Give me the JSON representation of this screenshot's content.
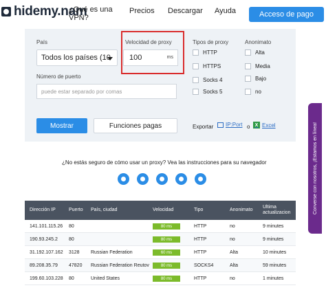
{
  "header": {
    "logo_text": "hidemy.nam",
    "nav_whatis": "¿Qué es una VPN?",
    "nav_precios": "Precios",
    "nav_descargar": "Descargar",
    "nav_ayuda": "Ayuda",
    "cta_label": "Acceso de pago"
  },
  "filters": {
    "country_label": "País",
    "country_value": "Todos los países (10",
    "speed_label": "Velocidad de proxy",
    "speed_value": "100",
    "speed_unit": "ms",
    "port_label": "Número de puerto",
    "port_placeholder": "puede estar separado por comas",
    "types_label": "Tipos de proxy",
    "types": [
      "HTTP",
      "HTTPS",
      "Socks 4",
      "Socks 5"
    ],
    "anon_label": "Anonimato",
    "anon": [
      "Alta",
      "Media",
      "Bajo",
      "no"
    ],
    "show_button": "Mostrar",
    "paid_button": "Funciones pagas",
    "export_label": "Exportar",
    "export_ipport": "IP:Port",
    "export_or": "o",
    "export_excel": "Excel"
  },
  "help": {
    "text": "¿No estás seguro de cómo usar un proxy? Vea las instrucciones para su navegador",
    "browsers": [
      "firefox-icon",
      "chrome-icon",
      "opera-icon",
      "ie-icon",
      "safari-icon"
    ]
  },
  "side_tab": {
    "text": "Converse con nosotros, ¡Estamos en línea!"
  },
  "table": {
    "headers": [
      "Dirección IP",
      "Puerto",
      "País, ciudad",
      "Velocidad",
      "Tipo",
      "Anonimato",
      "Ultima actualizacion"
    ],
    "rows": [
      {
        "ip": "141.101.115.26",
        "port": "80",
        "country": "",
        "speed": "80 ms",
        "speed_fill": 1.0,
        "type": "HTTP",
        "anon": "no",
        "updated": "9 minutes"
      },
      {
        "ip": "190.93.245.2",
        "port": "80",
        "country": "",
        "speed": "80 ms",
        "speed_fill": 1.0,
        "type": "HTTP",
        "anon": "no",
        "updated": "9 minutes"
      },
      {
        "ip": "31.192.107.162",
        "port": "3128",
        "country": "Russian Federation",
        "speed": "60 ms",
        "speed_fill": 1.0,
        "type": "HTTP",
        "anon": "Alta",
        "updated": "10 minutes"
      },
      {
        "ip": "89.208.35.79",
        "port": "47820",
        "country": "Russian Federation Reutov",
        "speed": "80 ms",
        "speed_fill": 1.0,
        "type": "SOCKS4",
        "anon": "Alta",
        "updated": "59 minutes"
      },
      {
        "ip": "199.60.103.228",
        "port": "80",
        "country": "United States",
        "speed": "80 ms",
        "speed_fill": 1.0,
        "type": "HTTP",
        "anon": "no",
        "updated": "1 minutes"
      }
    ]
  },
  "colors": {
    "primary": "#2b8de6",
    "highlight": "#d92b2b",
    "speed_good": "#7cbb2b",
    "table_header": "#4a5360",
    "side_tab": "#6b2a8c"
  }
}
